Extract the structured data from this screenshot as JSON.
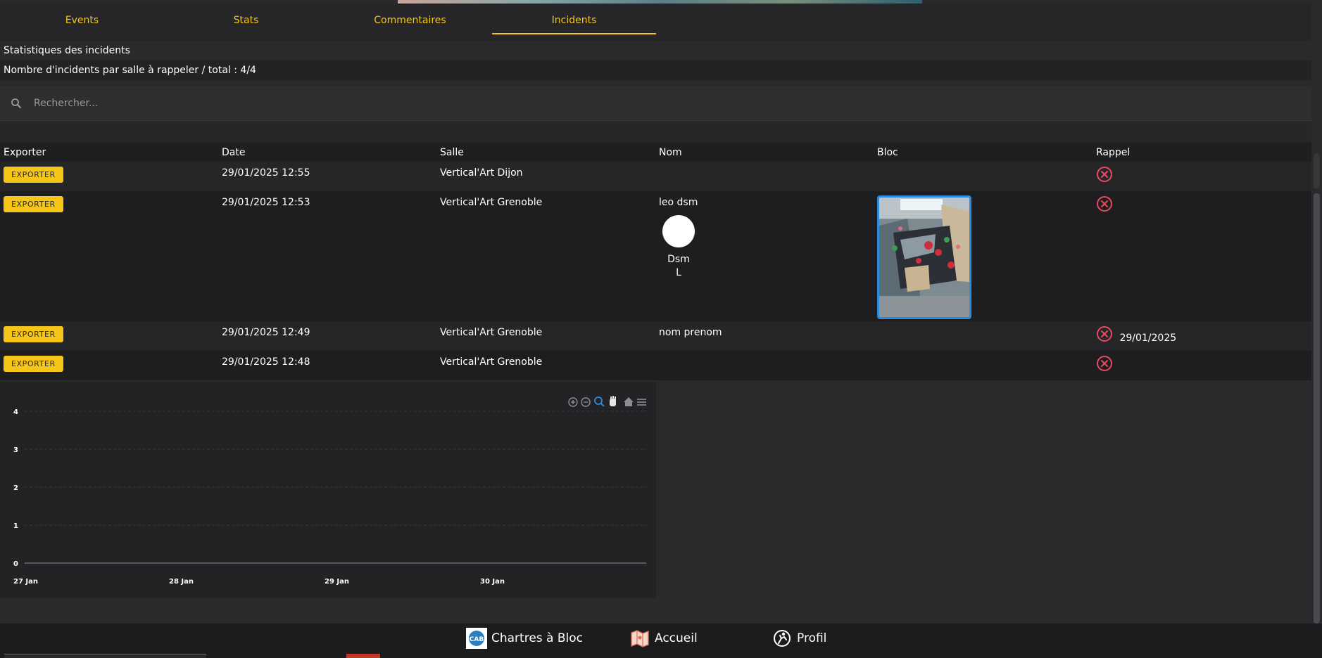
{
  "tabs": [
    {
      "label": "Events"
    },
    {
      "label": "Stats"
    },
    {
      "label": "Commentaires"
    },
    {
      "label": "Incidents"
    }
  ],
  "active_tab": "Incidents",
  "section_title": "Statistiques des incidents",
  "summary_text": "Nombre d'incidents par salle à rappeler / total : 4/4",
  "search": {
    "placeholder": "Rechercher..."
  },
  "table": {
    "headers": [
      "Exporter",
      "Date",
      "Salle",
      "Nom",
      "Bloc",
      "Rappel"
    ],
    "export_label": "EXPORTER",
    "rows": [
      {
        "date": "29/01/2025 12:55",
        "salle": "Vertical'Art Dijon",
        "nom": "",
        "rappel_date": ""
      },
      {
        "date": "29/01/2025 12:53",
        "salle": "Vertical'Art Grenoble",
        "nom": "leo dsm",
        "avatar_line1": "Dsm",
        "avatar_line2": "L",
        "rappel_date": ""
      },
      {
        "date": "29/01/2025 12:49",
        "salle": "Vertical'Art Grenoble",
        "nom": "nom prenom",
        "rappel_date": "29/01/2025"
      },
      {
        "date": "29/01/2025 12:48",
        "salle": "Vertical'Art Grenoble",
        "nom": "",
        "rappel_date": ""
      }
    ]
  },
  "chart_data": {
    "type": "line",
    "x": [
      "27 Jan",
      "28 Jan",
      "29 Jan",
      "30 Jan"
    ],
    "series": [
      {
        "values": [
          0,
          0,
          0,
          0
        ]
      }
    ],
    "ylim": [
      0,
      4
    ],
    "yticks": [
      "0",
      "1",
      "2",
      "3",
      "4"
    ],
    "grid": true,
    "toolbar": [
      "zoom-in-icon",
      "zoom-out-icon",
      "zoom-select-icon",
      "pan-hand-icon",
      "home-icon",
      "menu-icon"
    ]
  },
  "colors": {
    "accent": "#f5c518",
    "danger": "#e84a5f",
    "selected_border": "#2a8be0"
  },
  "bottom_nav": {
    "chartres": "Chartres à Bloc",
    "accueil": "Accueil",
    "profil": "Profil",
    "cab_logo": "CAB"
  }
}
